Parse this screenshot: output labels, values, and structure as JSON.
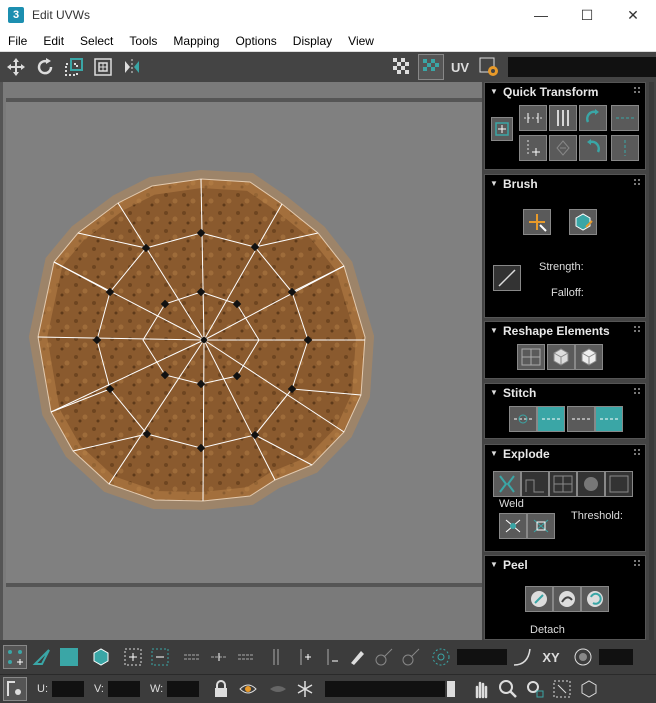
{
  "window": {
    "title": "Edit UVWs",
    "app_badge": "3",
    "minimize": "—",
    "maximize": "☐",
    "close": "✕"
  },
  "menu": [
    "File",
    "Edit",
    "Select",
    "Tools",
    "Mapping",
    "Options",
    "Display",
    "View"
  ],
  "toolbar": {
    "uv_label": "UV"
  },
  "panel": {
    "quick_transform": {
      "title": "Quick Transform"
    },
    "brush": {
      "title": "Brush",
      "strength_label": "Strength:",
      "falloff_label": "Falloff:"
    },
    "reshape": {
      "title": "Reshape Elements"
    },
    "stitch": {
      "title": "Stitch"
    },
    "explode": {
      "title": "Explode",
      "weld_label": "Weld",
      "threshold_label": "Threshold:"
    },
    "peel": {
      "title": "Peel",
      "detach_label": "Detach"
    }
  },
  "bottom": {
    "xy_label": "XY",
    "u_label": "U:",
    "v_label": "V:",
    "w_label": "W:"
  },
  "colors": {
    "accent": "#3aa6a6",
    "viewport": "#7a7a7a",
    "panel": "#000000",
    "cookie": "#8a5a2e"
  }
}
